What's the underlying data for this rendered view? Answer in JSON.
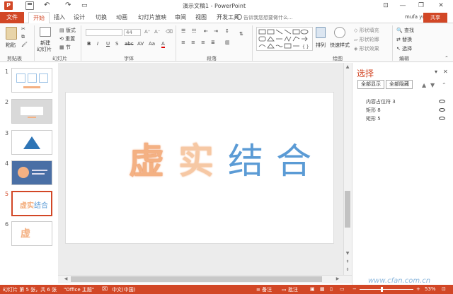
{
  "window": {
    "title": "演示文稿1 - PowerPoint",
    "app_icon": "P",
    "minimize": "—",
    "restore": "❐",
    "close": "✕",
    "ribbon_display": "⊡"
  },
  "tabs": {
    "file": "文件",
    "items": [
      "开始",
      "插入",
      "设计",
      "切换",
      "动画",
      "幻灯片放映",
      "审阅",
      "视图",
      "开发工具"
    ],
    "active": "开始",
    "tell_me": "告诉我您想要做什么...",
    "user": "mufa yu",
    "share": "共享"
  },
  "ribbon": {
    "clipboard": {
      "paste": "粘贴",
      "label": "剪贴板"
    },
    "slides": {
      "new_slide": "新建",
      "new_slide2": "幻灯片",
      "layout": "版式",
      "reset": "重置",
      "section": "节",
      "label": "幻灯片"
    },
    "font": {
      "size": "44",
      "label": "字体",
      "bold": "B",
      "italic": "I",
      "underline": "U",
      "strike": "S",
      "abc": "abc",
      "av": "AV",
      "aa": "Aa",
      "font_color": "A"
    },
    "paragraph": {
      "label": "段落"
    },
    "drawing": {
      "arrange": "排列",
      "quick_styles": "快速样式",
      "fill": "形状填充",
      "outline": "形状轮廓",
      "effects": "形状效果",
      "label": "绘图"
    },
    "editing": {
      "find": "查找",
      "replace": "替换",
      "select": "选择",
      "label": "编辑"
    }
  },
  "thumbnails": [
    {
      "num": "1",
      "selected": false
    },
    {
      "num": "2",
      "selected": false
    },
    {
      "num": "3",
      "selected": false
    },
    {
      "num": "4",
      "selected": false
    },
    {
      "num": "5",
      "selected": true,
      "text": "虚实结合"
    },
    {
      "num": "6",
      "selected": false,
      "text": "虚"
    }
  ],
  "slide": {
    "chars": [
      "虚",
      "实",
      "结",
      "合"
    ]
  },
  "selection_pane": {
    "title": "选择",
    "show_all": "全部显示",
    "hide_all": "全部隐藏",
    "objects": [
      "内容占位符 3",
      "矩形 8",
      "矩形 5"
    ]
  },
  "status": {
    "slide_info": "幻灯片 第 5 张，共 6 张",
    "theme": "\"Office 主题\"",
    "lang": "中文(中国)",
    "notes": "备注",
    "comments": "批注",
    "zoom": "53%"
  },
  "watermark": "www.cfan.com.cn",
  "colors": {
    "accent": "#d24726",
    "blue": "#5b9bd5",
    "peach": "#f4b183"
  }
}
